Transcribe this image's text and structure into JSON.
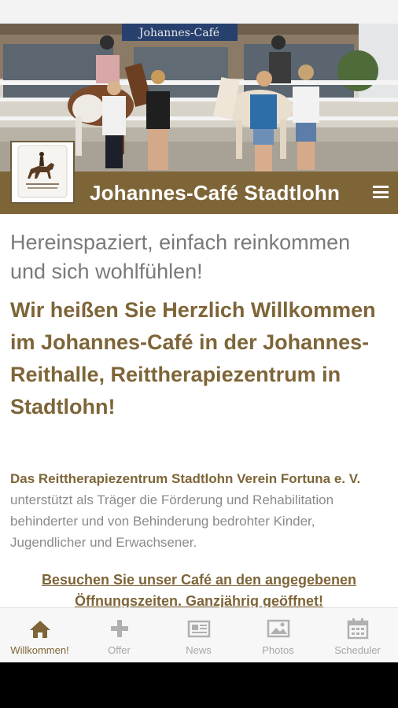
{
  "header": {
    "title": "Johannes-Café Stadtlohn",
    "sign_text": "Johannes-Café"
  },
  "intro": "Hereinspaziert, einfach reinkommen und sich wohlfühlen!",
  "welcome": "Wir heißen Sie Herzlich Willkommen im Johannes-Café in der Johannes-Reithalle, Reittherapiezentrum in Stadtlohn!",
  "paragraph": {
    "bold": "Das Reittherapiezentrum Stadtlohn Verein Fortuna e. V.",
    "text": " unterstützt als Träger die Förderung und Rehabilitation behinderter und von Behinderung bedrohter Kinder, Jugendlicher und Erwachsener."
  },
  "visit": "Besuchen Sie unser Café an den angegebenen Öffnungszeiten. Ganzjährig geöffnet!",
  "tabs": [
    {
      "label": "Willkommen!",
      "icon": "home-icon",
      "active": true
    },
    {
      "label": "Offer",
      "icon": "plus-icon",
      "active": false
    },
    {
      "label": "News",
      "icon": "newspaper-icon",
      "active": false
    },
    {
      "label": "Photos",
      "icon": "image-icon",
      "active": false
    },
    {
      "label": "Scheduler",
      "icon": "calendar-icon",
      "active": false
    }
  ],
  "colors": {
    "brand": "#7e6538",
    "inactive_tab": "#a6a6a6",
    "intro_text": "#7a7a7a"
  }
}
